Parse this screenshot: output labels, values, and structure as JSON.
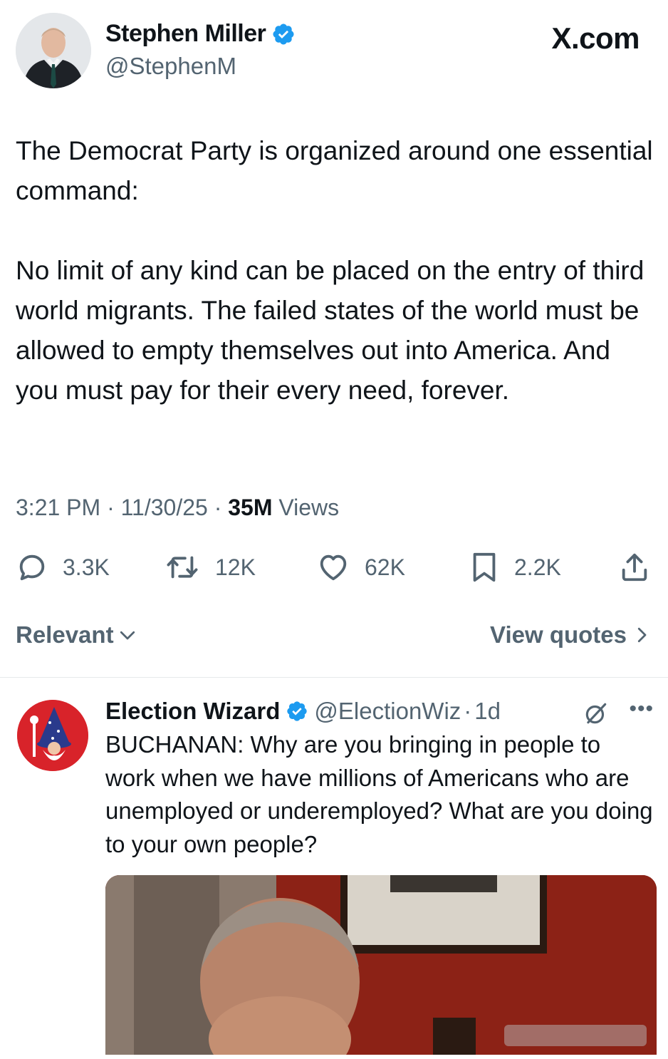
{
  "brand": "X.com",
  "tweet": {
    "author_name": "Stephen Miller",
    "author_handle": "@StephenM",
    "paragraphs": [
      "The Democrat Party is organized around one essential command:",
      "No limit of any kind can be placed on the entry of third world migrants. The failed states of the world must be allowed to empty themselves out into America. And you must pay for their every need, forever."
    ],
    "time": "3:21 PM",
    "date": "11/30/25",
    "views_count": "35M",
    "views_label": "Views",
    "stats": {
      "replies": "3.3K",
      "reposts": "12K",
      "likes": "62K",
      "bookmarks": "2.2K"
    }
  },
  "filters": {
    "sort_label": "Relevant",
    "view_quotes_label": "View quotes"
  },
  "reply": {
    "author_name": "Election Wizard",
    "author_handle": "@ElectionWiz",
    "time": "1d",
    "text": "BUCHANAN: Why are you bringing in people to work when we have millions of Americans who are unemployed or underemployed? What are you doing to your own people?"
  },
  "colors": {
    "text": "#0f1419",
    "secondary": "#536471",
    "verified": "#1d9bf0",
    "divider": "#e6e9ea"
  },
  "icons": [
    "verified-badge-icon",
    "reply-icon",
    "repost-icon",
    "like-icon",
    "bookmark-icon",
    "share-icon",
    "chevron-down-icon",
    "chevron-right-icon",
    "grok-icon",
    "more-icon"
  ]
}
